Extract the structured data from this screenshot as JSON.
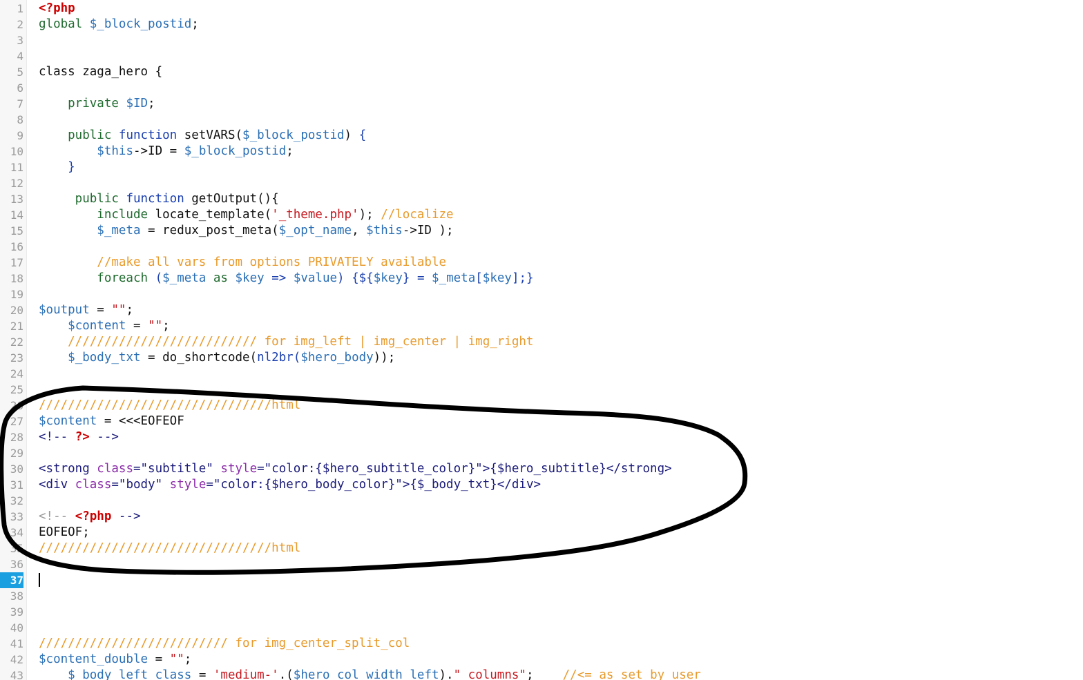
{
  "editor": {
    "active_line": 37,
    "colors": {
      "default": "#111111",
      "php_tag": "#cc0000",
      "keyword": "#1a3fae",
      "variable": "#2a6fb5",
      "string": "#c6181f",
      "comment": "#e89a2a",
      "html_tag": "#1a1a7a",
      "attr": "#8a2aa8",
      "line_number": "#9a9a9a",
      "active_line_bg": "#1a9fe0"
    },
    "lines": [
      {
        "n": "1",
        "tokens": [
          [
            "<?php",
            "php_tag"
          ]
        ]
      },
      {
        "n": "2",
        "tokens": [
          [
            "global ",
            "kwgreen"
          ],
          [
            "$_block_postid",
            "variable"
          ],
          [
            ";",
            "default"
          ]
        ]
      },
      {
        "n": "3",
        "tokens": []
      },
      {
        "n": "4",
        "tokens": []
      },
      {
        "n": "5",
        "tokens": [
          [
            "class zaga_hero {",
            "default"
          ]
        ]
      },
      {
        "n": "6",
        "tokens": []
      },
      {
        "n": "7",
        "tokens": [
          [
            "    private ",
            "kwgreen"
          ],
          [
            "$ID",
            "variable"
          ],
          [
            ";",
            "default"
          ]
        ]
      },
      {
        "n": "8",
        "tokens": []
      },
      {
        "n": "9",
        "tokens": [
          [
            "    public ",
            "kwgreen"
          ],
          [
            "function ",
            "keyword"
          ],
          [
            "setVARS(",
            "default"
          ],
          [
            "$_block_postid",
            "variable"
          ],
          [
            ") ",
            "default"
          ],
          [
            "{",
            "keyword"
          ]
        ]
      },
      {
        "n": "10",
        "tokens": [
          [
            "        ",
            "default"
          ],
          [
            "$this",
            "variable"
          ],
          [
            "->ID = ",
            "default"
          ],
          [
            "$_block_postid",
            "variable"
          ],
          [
            ";",
            "default"
          ]
        ]
      },
      {
        "n": "11",
        "tokens": [
          [
            "    }",
            "keyword"
          ]
        ]
      },
      {
        "n": "12",
        "tokens": []
      },
      {
        "n": "13",
        "tokens": [
          [
            "     public ",
            "kwgreen"
          ],
          [
            "function ",
            "keyword"
          ],
          [
            "getOutput(){",
            "default"
          ]
        ]
      },
      {
        "n": "14",
        "tokens": [
          [
            "        include ",
            "kwgreen"
          ],
          [
            "locate_template(",
            "default"
          ],
          [
            "'_theme.php'",
            "string"
          ],
          [
            "); ",
            "default"
          ],
          [
            "//localize",
            "comment"
          ]
        ]
      },
      {
        "n": "15",
        "tokens": [
          [
            "        ",
            "default"
          ],
          [
            "$_meta",
            "variable"
          ],
          [
            " = redux_post_meta(",
            "default"
          ],
          [
            "$_opt_name",
            "variable"
          ],
          [
            ", ",
            "default"
          ],
          [
            "$this",
            "variable"
          ],
          [
            "->ID );",
            "default"
          ]
        ]
      },
      {
        "n": "16",
        "tokens": []
      },
      {
        "n": "17",
        "tokens": [
          [
            "        //make all vars from options PRIVATELY available",
            "comment"
          ]
        ]
      },
      {
        "n": "18",
        "tokens": [
          [
            "        foreach ",
            "kwgreen"
          ],
          [
            "(",
            "keyword"
          ],
          [
            "$_meta",
            "variable"
          ],
          [
            " as ",
            "kwgreen"
          ],
          [
            "$key",
            "variable"
          ],
          [
            " => ",
            "keyword"
          ],
          [
            "$value",
            "variable"
          ],
          [
            ") {${",
            "keyword"
          ],
          [
            "$key",
            "variable"
          ],
          [
            "} = ",
            "keyword"
          ],
          [
            "$_meta",
            "variable"
          ],
          [
            "[",
            "keyword"
          ],
          [
            "$key",
            "variable"
          ],
          [
            "];}",
            "keyword"
          ]
        ]
      },
      {
        "n": "19",
        "tokens": []
      },
      {
        "n": "20",
        "tokens": [
          [
            "$output",
            "variable"
          ],
          [
            " = ",
            "default"
          ],
          [
            "\"\"",
            "string"
          ],
          [
            ";",
            "default"
          ]
        ]
      },
      {
        "n": "21",
        "tokens": [
          [
            "    ",
            "default"
          ],
          [
            "$content",
            "variable"
          ],
          [
            " = ",
            "default"
          ],
          [
            "\"\"",
            "string"
          ],
          [
            ";",
            "default"
          ]
        ]
      },
      {
        "n": "22",
        "tokens": [
          [
            "    ////////////////////////// for img_left | img_center | img_right",
            "comment"
          ]
        ]
      },
      {
        "n": "23",
        "tokens": [
          [
            "    ",
            "default"
          ],
          [
            "$_body_txt",
            "variable"
          ],
          [
            " = do_shortcode(",
            "default"
          ],
          [
            "nl2br(",
            "keyword"
          ],
          [
            "$hero_body",
            "variable"
          ],
          [
            "));",
            "default"
          ]
        ]
      },
      {
        "n": "24",
        "tokens": []
      },
      {
        "n": "25",
        "tokens": []
      },
      {
        "n": "26",
        "tokens": [
          [
            "////////////////////////////////html",
            "comment"
          ]
        ]
      },
      {
        "n": "27",
        "tokens": [
          [
            "$content",
            "variable"
          ],
          [
            " = <<<EOFEOF",
            "default"
          ]
        ]
      },
      {
        "n": "28",
        "tokens": [
          [
            "<!-- ",
            "html_tag"
          ],
          [
            "?>",
            "php_tag"
          ],
          [
            " -->",
            "html_tag"
          ]
        ]
      },
      {
        "n": "29",
        "tokens": []
      },
      {
        "n": "30",
        "tokens": [
          [
            "<strong ",
            "html_tag"
          ],
          [
            "class",
            "attr"
          ],
          [
            "=\"subtitle\" ",
            "html_tag"
          ],
          [
            "style",
            "attr"
          ],
          [
            "=\"color:{$hero_subtitle_color}\">{$hero_subtitle}</strong>",
            "html_tag"
          ]
        ]
      },
      {
        "n": "31",
        "tokens": [
          [
            "<div ",
            "html_tag"
          ],
          [
            "class",
            "attr"
          ],
          [
            "=\"body\" ",
            "html_tag"
          ],
          [
            "style",
            "attr"
          ],
          [
            "=\"color:{$hero_body_color}\">{$_body_txt}</div>",
            "html_tag"
          ]
        ]
      },
      {
        "n": "32",
        "tokens": []
      },
      {
        "n": "33",
        "tokens": [
          [
            "<!-- ",
            "grey"
          ],
          [
            "<?php",
            "php_tag"
          ],
          [
            " -->",
            "html_tag"
          ]
        ]
      },
      {
        "n": "34",
        "tokens": [
          [
            "EOFEOF;",
            "default"
          ]
        ]
      },
      {
        "n": "35",
        "tokens": [
          [
            "////////////////////////////////html",
            "comment"
          ]
        ]
      },
      {
        "n": "36",
        "tokens": []
      },
      {
        "n": "37",
        "tokens": [],
        "cursor": true
      },
      {
        "n": "38",
        "tokens": []
      },
      {
        "n": "39",
        "tokens": []
      },
      {
        "n": "40",
        "tokens": []
      },
      {
        "n": "41",
        "tokens": [
          [
            "////////////////////////// for img_center_split_col",
            "comment"
          ]
        ]
      },
      {
        "n": "42",
        "tokens": [
          [
            "$content_double",
            "variable"
          ],
          [
            " = ",
            "default"
          ],
          [
            "\"\"",
            "string"
          ],
          [
            ";",
            "default"
          ]
        ]
      },
      {
        "n": "43",
        "tokens": [
          [
            "    ",
            "default"
          ],
          [
            "$_body_left_class",
            "variable"
          ],
          [
            " = ",
            "default"
          ],
          [
            "'medium-'",
            "string"
          ],
          [
            ".(",
            "default"
          ],
          [
            "$hero_col_width_left",
            "variable"
          ],
          [
            ").",
            "default"
          ],
          [
            "\" columns\"",
            "string"
          ],
          [
            ";    ",
            "default"
          ],
          [
            "//<= as set by user",
            "comment"
          ]
        ]
      }
    ]
  }
}
